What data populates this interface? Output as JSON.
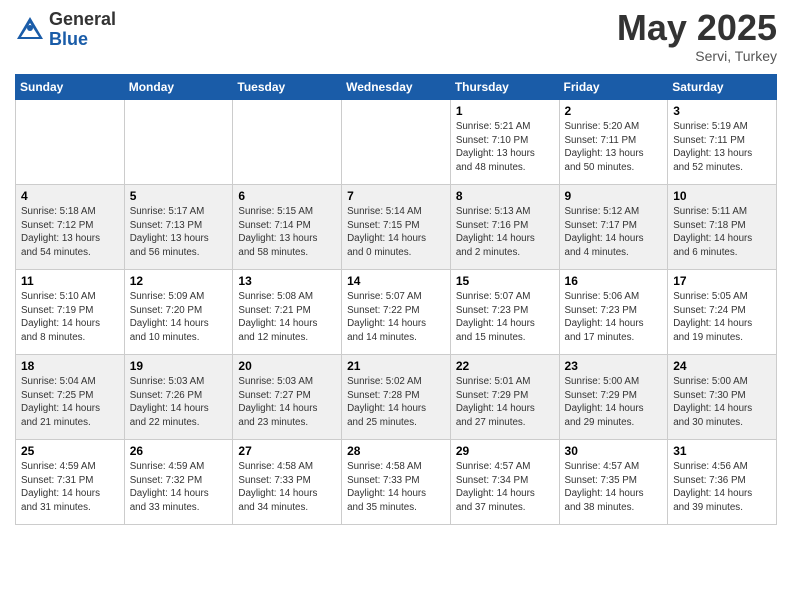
{
  "header": {
    "logo_general": "General",
    "logo_blue": "Blue",
    "month_year": "May 2025",
    "location": "Servi, Turkey"
  },
  "weekdays": [
    "Sunday",
    "Monday",
    "Tuesday",
    "Wednesday",
    "Thursday",
    "Friday",
    "Saturday"
  ],
  "weeks": [
    [
      {
        "day": "",
        "info": ""
      },
      {
        "day": "",
        "info": ""
      },
      {
        "day": "",
        "info": ""
      },
      {
        "day": "",
        "info": ""
      },
      {
        "day": "1",
        "info": "Sunrise: 5:21 AM\nSunset: 7:10 PM\nDaylight: 13 hours\nand 48 minutes."
      },
      {
        "day": "2",
        "info": "Sunrise: 5:20 AM\nSunset: 7:11 PM\nDaylight: 13 hours\nand 50 minutes."
      },
      {
        "day": "3",
        "info": "Sunrise: 5:19 AM\nSunset: 7:11 PM\nDaylight: 13 hours\nand 52 minutes."
      }
    ],
    [
      {
        "day": "4",
        "info": "Sunrise: 5:18 AM\nSunset: 7:12 PM\nDaylight: 13 hours\nand 54 minutes."
      },
      {
        "day": "5",
        "info": "Sunrise: 5:17 AM\nSunset: 7:13 PM\nDaylight: 13 hours\nand 56 minutes."
      },
      {
        "day": "6",
        "info": "Sunrise: 5:15 AM\nSunset: 7:14 PM\nDaylight: 13 hours\nand 58 minutes."
      },
      {
        "day": "7",
        "info": "Sunrise: 5:14 AM\nSunset: 7:15 PM\nDaylight: 14 hours\nand 0 minutes."
      },
      {
        "day": "8",
        "info": "Sunrise: 5:13 AM\nSunset: 7:16 PM\nDaylight: 14 hours\nand 2 minutes."
      },
      {
        "day": "9",
        "info": "Sunrise: 5:12 AM\nSunset: 7:17 PM\nDaylight: 14 hours\nand 4 minutes."
      },
      {
        "day": "10",
        "info": "Sunrise: 5:11 AM\nSunset: 7:18 PM\nDaylight: 14 hours\nand 6 minutes."
      }
    ],
    [
      {
        "day": "11",
        "info": "Sunrise: 5:10 AM\nSunset: 7:19 PM\nDaylight: 14 hours\nand 8 minutes."
      },
      {
        "day": "12",
        "info": "Sunrise: 5:09 AM\nSunset: 7:20 PM\nDaylight: 14 hours\nand 10 minutes."
      },
      {
        "day": "13",
        "info": "Sunrise: 5:08 AM\nSunset: 7:21 PM\nDaylight: 14 hours\nand 12 minutes."
      },
      {
        "day": "14",
        "info": "Sunrise: 5:07 AM\nSunset: 7:22 PM\nDaylight: 14 hours\nand 14 minutes."
      },
      {
        "day": "15",
        "info": "Sunrise: 5:07 AM\nSunset: 7:23 PM\nDaylight: 14 hours\nand 15 minutes."
      },
      {
        "day": "16",
        "info": "Sunrise: 5:06 AM\nSunset: 7:23 PM\nDaylight: 14 hours\nand 17 minutes."
      },
      {
        "day": "17",
        "info": "Sunrise: 5:05 AM\nSunset: 7:24 PM\nDaylight: 14 hours\nand 19 minutes."
      }
    ],
    [
      {
        "day": "18",
        "info": "Sunrise: 5:04 AM\nSunset: 7:25 PM\nDaylight: 14 hours\nand 21 minutes."
      },
      {
        "day": "19",
        "info": "Sunrise: 5:03 AM\nSunset: 7:26 PM\nDaylight: 14 hours\nand 22 minutes."
      },
      {
        "day": "20",
        "info": "Sunrise: 5:03 AM\nSunset: 7:27 PM\nDaylight: 14 hours\nand 23 minutes."
      },
      {
        "day": "21",
        "info": "Sunrise: 5:02 AM\nSunset: 7:28 PM\nDaylight: 14 hours\nand 25 minutes."
      },
      {
        "day": "22",
        "info": "Sunrise: 5:01 AM\nSunset: 7:29 PM\nDaylight: 14 hours\nand 27 minutes."
      },
      {
        "day": "23",
        "info": "Sunrise: 5:00 AM\nSunset: 7:29 PM\nDaylight: 14 hours\nand 29 minutes."
      },
      {
        "day": "24",
        "info": "Sunrise: 5:00 AM\nSunset: 7:30 PM\nDaylight: 14 hours\nand 30 minutes."
      }
    ],
    [
      {
        "day": "25",
        "info": "Sunrise: 4:59 AM\nSunset: 7:31 PM\nDaylight: 14 hours\nand 31 minutes."
      },
      {
        "day": "26",
        "info": "Sunrise: 4:59 AM\nSunset: 7:32 PM\nDaylight: 14 hours\nand 33 minutes."
      },
      {
        "day": "27",
        "info": "Sunrise: 4:58 AM\nSunset: 7:33 PM\nDaylight: 14 hours\nand 34 minutes."
      },
      {
        "day": "28",
        "info": "Sunrise: 4:58 AM\nSunset: 7:33 PM\nDaylight: 14 hours\nand 35 minutes."
      },
      {
        "day": "29",
        "info": "Sunrise: 4:57 AM\nSunset: 7:34 PM\nDaylight: 14 hours\nand 37 minutes."
      },
      {
        "day": "30",
        "info": "Sunrise: 4:57 AM\nSunset: 7:35 PM\nDaylight: 14 hours\nand 38 minutes."
      },
      {
        "day": "31",
        "info": "Sunrise: 4:56 AM\nSunset: 7:36 PM\nDaylight: 14 hours\nand 39 minutes."
      }
    ]
  ]
}
